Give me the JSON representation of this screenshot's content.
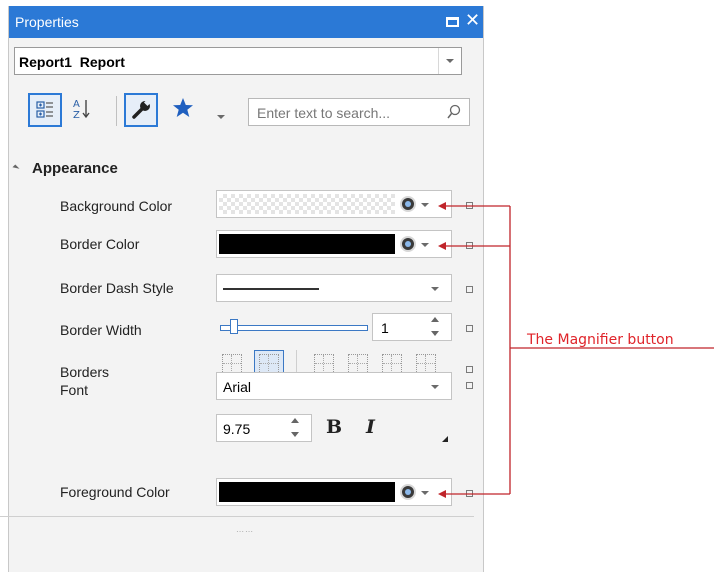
{
  "window": {
    "title": "Properties"
  },
  "object_selector": {
    "value": "Report1  Report"
  },
  "toolbar": {
    "search_placeholder": "Enter text to search..."
  },
  "group": {
    "name": "Appearance"
  },
  "properties": {
    "background_color": {
      "label": "Background Color"
    },
    "border_color": {
      "label": "Border Color"
    },
    "border_dash_style": {
      "label": "Border Dash Style"
    },
    "border_width": {
      "label": "Border Width",
      "value": "1"
    },
    "borders": {
      "label": "Borders"
    },
    "font": {
      "label": "Font",
      "family": "Arial",
      "size": "9.75",
      "bold": "B",
      "italic": "I"
    },
    "foreground_color": {
      "label": "Foreground Color"
    }
  },
  "annotation": {
    "text": "The Magnifier button",
    "color": "#e0242a"
  },
  "colors": {
    "titlebar": "#2b79d6",
    "panel": "#f3f3f3",
    "border_color_value": "#000000"
  }
}
